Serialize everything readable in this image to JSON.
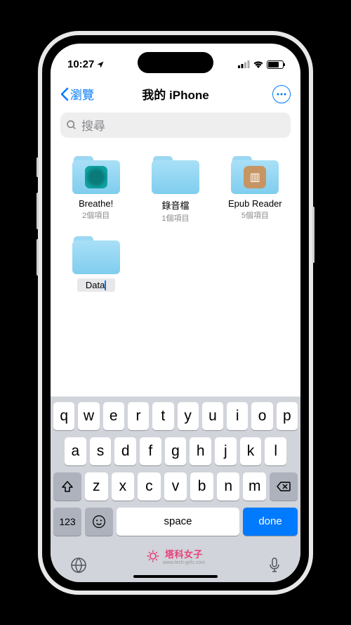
{
  "status": {
    "time": "10:27"
  },
  "nav": {
    "back_label": "瀏覽",
    "title": "我的 iPhone"
  },
  "search": {
    "placeholder": "搜尋"
  },
  "folders": [
    {
      "name": "Breathe!",
      "count": "2個項目"
    },
    {
      "name": "錄音檔",
      "count": "1個項目"
    },
    {
      "name": "Epub Reader",
      "count": "5個項目"
    }
  ],
  "new_folder": {
    "name": "Data"
  },
  "keyboard": {
    "row1": [
      "q",
      "w",
      "e",
      "r",
      "t",
      "y",
      "u",
      "i",
      "o",
      "p"
    ],
    "row2": [
      "a",
      "s",
      "d",
      "f",
      "g",
      "h",
      "j",
      "k",
      "l"
    ],
    "row3": [
      "z",
      "x",
      "c",
      "v",
      "b",
      "n",
      "m"
    ],
    "num_key": "123",
    "space": "space",
    "done": "done"
  },
  "watermark": {
    "text": "塔科女子",
    "url": "www.tech-girlz.com"
  }
}
